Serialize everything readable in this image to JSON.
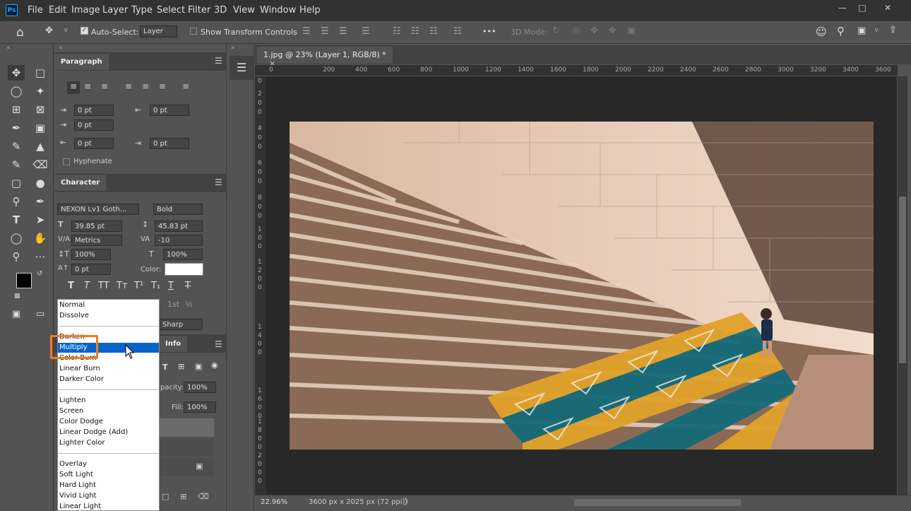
{
  "app": {
    "logo_text": "Ps"
  },
  "menu": [
    "File",
    "Edit",
    "Image",
    "Layer",
    "Type",
    "Select",
    "Filter",
    "3D",
    "View",
    "Window",
    "Help"
  ],
  "options_bar": {
    "auto_select_label": "Auto-Select:",
    "auto_select_target": "Layer",
    "show_transform_label": "Show Transform Controls",
    "threed_mode_label": "3D Mode:",
    "more_label": "•••"
  },
  "paragraph": {
    "title": "Paragraph",
    "indent_left": "0 pt",
    "indent_right": "0 pt",
    "indent_first": "0 pt",
    "space_before": "0 pt",
    "space_after": "0 pt",
    "hyphenate_label": "Hyphenate"
  },
  "character": {
    "title": "Character",
    "font_family": "NEXON Lv1 Goth...",
    "font_style": "Bold",
    "font_size": "39.85 pt",
    "leading": "45.83 pt",
    "kerning": "Metrics",
    "tracking": "-10",
    "vertical_scale": "100%",
    "horizontal_scale": "100%",
    "baseline_shift": "0 pt",
    "color_label": "Color:",
    "antialias": "Sharp"
  },
  "layers_panel": {
    "info_tab": "Info",
    "opacity_label": "pacity:",
    "opacity_value": "100%",
    "fill_label": "Fill:",
    "fill_value": "100%"
  },
  "blend_modes": [
    [
      "Normal",
      "Dissolve"
    ],
    [
      "Darken",
      "Multiply",
      "Color Burn",
      "Linear Burn",
      "Darker Color"
    ],
    [
      "Lighten",
      "Screen",
      "Color Dodge",
      "Linear Dodge (Add)",
      "Lighter Color"
    ],
    [
      "Overlay",
      "Soft Light",
      "Hard Light",
      "Vivid Light",
      "Linear Light"
    ]
  ],
  "blend_selected": "Multiply",
  "document": {
    "tab_title": "1.jpg @ 23% (Layer 1, RGB/8) *",
    "zoom": "22.96%",
    "dimensions": "3600 px x 2025 px (72 ppi)"
  },
  "ruler": {
    "top": [
      "0",
      "200",
      "400",
      "600",
      "800",
      "1000",
      "1200",
      "1400",
      "1600",
      "1800",
      "2000",
      "2200",
      "2400",
      "2600",
      "2800",
      "3000",
      "3200",
      "3400",
      "3600"
    ],
    "left": [
      "0",
      "2",
      "0",
      "0",
      "4",
      "0",
      "0",
      "6",
      "0",
      "0",
      "8",
      "0",
      "0",
      "1",
      "0",
      "0",
      "1",
      "2",
      "0",
      "0",
      "1",
      "4",
      "0",
      "0",
      "1",
      "6",
      "0",
      "0",
      "1",
      "8",
      "0",
      "0",
      "2",
      "0",
      "0",
      "0"
    ]
  },
  "colors": {
    "accent": "#31a8ff",
    "highlight": "#f47b20",
    "selection": "#0a64c8"
  }
}
